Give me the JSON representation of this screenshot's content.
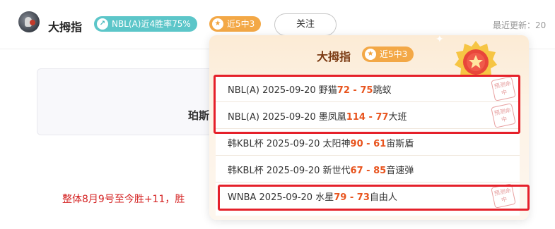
{
  "header": {
    "user_name": "大拇指",
    "nbl_badge": "NBL(A)近4胜率75%",
    "nbl_badge_icon": "arrow-up-icon",
    "streak_badge": "近5中3",
    "streak_icon": "star-icon",
    "follow_label": "关注",
    "update_label": "最近更新：20"
  },
  "background": {
    "title_fragment": "珀斯",
    "summary_fragment": "整体8月9号至今胜+11，胜"
  },
  "popup": {
    "title": "大拇指",
    "badge": "近5中3",
    "stamp_text": "预测命中",
    "rows": [
      {
        "league": "NBL(A)",
        "date": "2025-09-20",
        "home": "野猫",
        "score": "72 - 75",
        "away": "跳蚁",
        "hit": true
      },
      {
        "league": "NBL(A)",
        "date": "2025-09-20",
        "home": "墨凤凰",
        "score": "114 - 77",
        "away": "大班",
        "hit": true
      },
      {
        "league": "韩KBL杯",
        "date": "2025-09-20",
        "home": "太阳神",
        "score": "90 - 61",
        "away": "宙斯盾",
        "hit": false
      },
      {
        "league": "韩KBL杯",
        "date": "2025-09-20",
        "home": "新世代",
        "score": "67 - 85",
        "away": "音速弹",
        "hit": false
      },
      {
        "league": "WNBA",
        "date": "2025-09-20",
        "home": "水星",
        "score": "79 - 73",
        "away": "自由人",
        "hit": true
      }
    ]
  },
  "colors": {
    "score": "#e8541e",
    "highlight": "#e5202a",
    "badge_teal": "#5cc6c9",
    "badge_orange": "#f3a846"
  }
}
